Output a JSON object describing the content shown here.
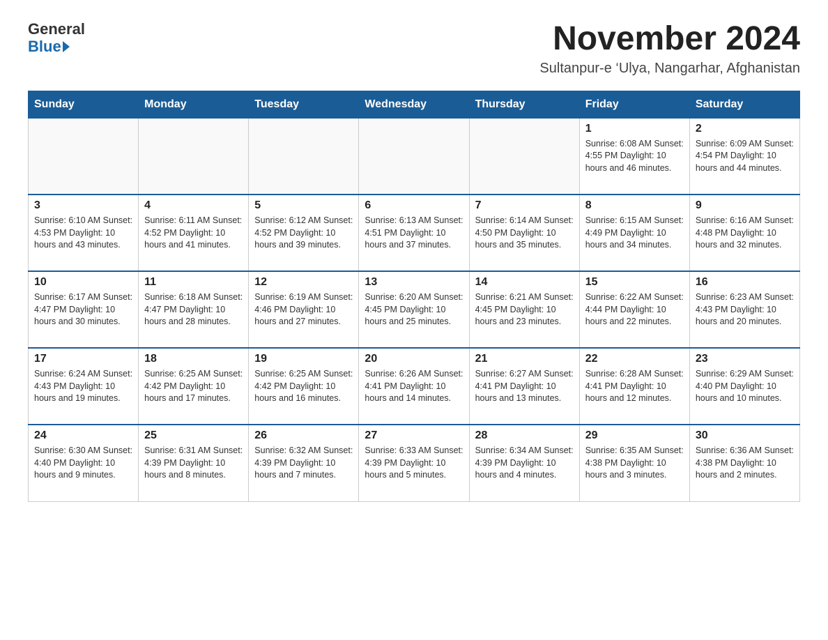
{
  "logo": {
    "general": "General",
    "blue": "Blue"
  },
  "title": "November 2024",
  "subtitle": "Sultanpur-e ‘Ulya, Nangarhar, Afghanistan",
  "days_of_week": [
    "Sunday",
    "Monday",
    "Tuesday",
    "Wednesday",
    "Thursday",
    "Friday",
    "Saturday"
  ],
  "weeks": [
    [
      {
        "day": "",
        "info": ""
      },
      {
        "day": "",
        "info": ""
      },
      {
        "day": "",
        "info": ""
      },
      {
        "day": "",
        "info": ""
      },
      {
        "day": "",
        "info": ""
      },
      {
        "day": "1",
        "info": "Sunrise: 6:08 AM\nSunset: 4:55 PM\nDaylight: 10 hours and 46 minutes."
      },
      {
        "day": "2",
        "info": "Sunrise: 6:09 AM\nSunset: 4:54 PM\nDaylight: 10 hours and 44 minutes."
      }
    ],
    [
      {
        "day": "3",
        "info": "Sunrise: 6:10 AM\nSunset: 4:53 PM\nDaylight: 10 hours and 43 minutes."
      },
      {
        "day": "4",
        "info": "Sunrise: 6:11 AM\nSunset: 4:52 PM\nDaylight: 10 hours and 41 minutes."
      },
      {
        "day": "5",
        "info": "Sunrise: 6:12 AM\nSunset: 4:52 PM\nDaylight: 10 hours and 39 minutes."
      },
      {
        "day": "6",
        "info": "Sunrise: 6:13 AM\nSunset: 4:51 PM\nDaylight: 10 hours and 37 minutes."
      },
      {
        "day": "7",
        "info": "Sunrise: 6:14 AM\nSunset: 4:50 PM\nDaylight: 10 hours and 35 minutes."
      },
      {
        "day": "8",
        "info": "Sunrise: 6:15 AM\nSunset: 4:49 PM\nDaylight: 10 hours and 34 minutes."
      },
      {
        "day": "9",
        "info": "Sunrise: 6:16 AM\nSunset: 4:48 PM\nDaylight: 10 hours and 32 minutes."
      }
    ],
    [
      {
        "day": "10",
        "info": "Sunrise: 6:17 AM\nSunset: 4:47 PM\nDaylight: 10 hours and 30 minutes."
      },
      {
        "day": "11",
        "info": "Sunrise: 6:18 AM\nSunset: 4:47 PM\nDaylight: 10 hours and 28 minutes."
      },
      {
        "day": "12",
        "info": "Sunrise: 6:19 AM\nSunset: 4:46 PM\nDaylight: 10 hours and 27 minutes."
      },
      {
        "day": "13",
        "info": "Sunrise: 6:20 AM\nSunset: 4:45 PM\nDaylight: 10 hours and 25 minutes."
      },
      {
        "day": "14",
        "info": "Sunrise: 6:21 AM\nSunset: 4:45 PM\nDaylight: 10 hours and 23 minutes."
      },
      {
        "day": "15",
        "info": "Sunrise: 6:22 AM\nSunset: 4:44 PM\nDaylight: 10 hours and 22 minutes."
      },
      {
        "day": "16",
        "info": "Sunrise: 6:23 AM\nSunset: 4:43 PM\nDaylight: 10 hours and 20 minutes."
      }
    ],
    [
      {
        "day": "17",
        "info": "Sunrise: 6:24 AM\nSunset: 4:43 PM\nDaylight: 10 hours and 19 minutes."
      },
      {
        "day": "18",
        "info": "Sunrise: 6:25 AM\nSunset: 4:42 PM\nDaylight: 10 hours and 17 minutes."
      },
      {
        "day": "19",
        "info": "Sunrise: 6:25 AM\nSunset: 4:42 PM\nDaylight: 10 hours and 16 minutes."
      },
      {
        "day": "20",
        "info": "Sunrise: 6:26 AM\nSunset: 4:41 PM\nDaylight: 10 hours and 14 minutes."
      },
      {
        "day": "21",
        "info": "Sunrise: 6:27 AM\nSunset: 4:41 PM\nDaylight: 10 hours and 13 minutes."
      },
      {
        "day": "22",
        "info": "Sunrise: 6:28 AM\nSunset: 4:41 PM\nDaylight: 10 hours and 12 minutes."
      },
      {
        "day": "23",
        "info": "Sunrise: 6:29 AM\nSunset: 4:40 PM\nDaylight: 10 hours and 10 minutes."
      }
    ],
    [
      {
        "day": "24",
        "info": "Sunrise: 6:30 AM\nSunset: 4:40 PM\nDaylight: 10 hours and 9 minutes."
      },
      {
        "day": "25",
        "info": "Sunrise: 6:31 AM\nSunset: 4:39 PM\nDaylight: 10 hours and 8 minutes."
      },
      {
        "day": "26",
        "info": "Sunrise: 6:32 AM\nSunset: 4:39 PM\nDaylight: 10 hours and 7 minutes."
      },
      {
        "day": "27",
        "info": "Sunrise: 6:33 AM\nSunset: 4:39 PM\nDaylight: 10 hours and 5 minutes."
      },
      {
        "day": "28",
        "info": "Sunrise: 6:34 AM\nSunset: 4:39 PM\nDaylight: 10 hours and 4 minutes."
      },
      {
        "day": "29",
        "info": "Sunrise: 6:35 AM\nSunset: 4:38 PM\nDaylight: 10 hours and 3 minutes."
      },
      {
        "day": "30",
        "info": "Sunrise: 6:36 AM\nSunset: 4:38 PM\nDaylight: 10 hours and 2 minutes."
      }
    ]
  ]
}
